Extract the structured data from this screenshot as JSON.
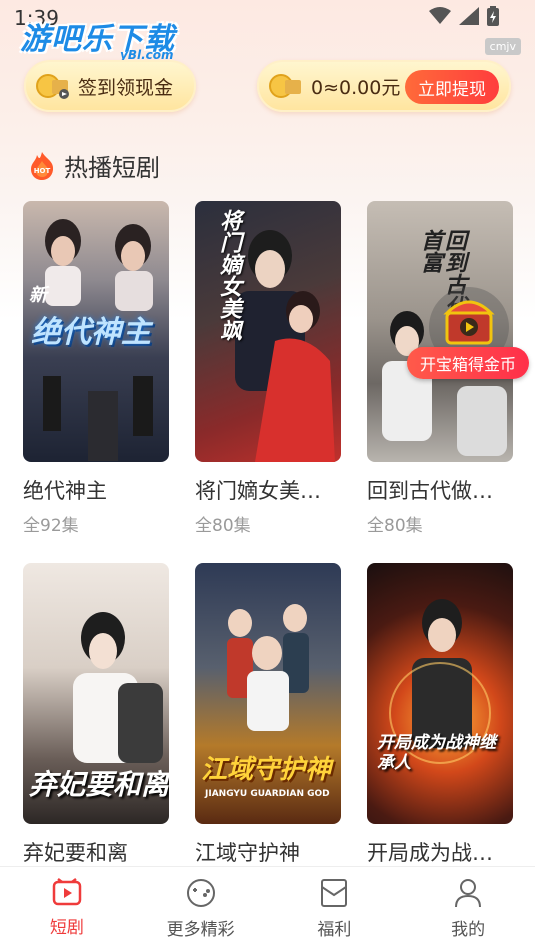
{
  "status_bar": {
    "time": "1:39"
  },
  "watermark": {
    "main": "游吧乐下载",
    "sub": "yBl.com"
  },
  "corner_tag": "cmjv",
  "signin": {
    "label": "签到领现金"
  },
  "balance": {
    "value": "0≈0.00元",
    "withdraw_label": "立即提现"
  },
  "section": {
    "title": "热播短剧",
    "hot_badge": "HOT"
  },
  "treasure": {
    "label": "开宝箱得金币"
  },
  "dramas": [
    {
      "title": "绝代神主",
      "episodes": "全92集",
      "poster_text": "绝代神主",
      "poster_tag": "新"
    },
    {
      "title": "将门嫡女美…",
      "episodes": "全80集",
      "poster_text": "将门嫡女美飒"
    },
    {
      "title": "回到古代做…",
      "episodes": "全80集",
      "poster_text": "回到古代做首富"
    },
    {
      "title": "弃妃要和离",
      "episodes": "",
      "poster_text": "弃妃要和离"
    },
    {
      "title": "江域守护神",
      "episodes": "",
      "poster_text": "江域守护神",
      "poster_sub": "JIANGYU GUARDIAN GOD"
    },
    {
      "title": "开局成为战…",
      "episodes": "",
      "poster_text": "开局成为战神继承人"
    }
  ],
  "nav": [
    {
      "label": "短剧",
      "icon": "play-box-icon",
      "active": true
    },
    {
      "label": "更多精彩",
      "icon": "game-controller-icon",
      "active": false
    },
    {
      "label": "福利",
      "icon": "envelope-icon",
      "active": false
    },
    {
      "label": "我的",
      "icon": "user-icon",
      "active": false
    }
  ],
  "colors": {
    "accent": "#ef3b3b",
    "gold_pill": "#ffe5a0",
    "withdraw": "#ff3d3d"
  }
}
